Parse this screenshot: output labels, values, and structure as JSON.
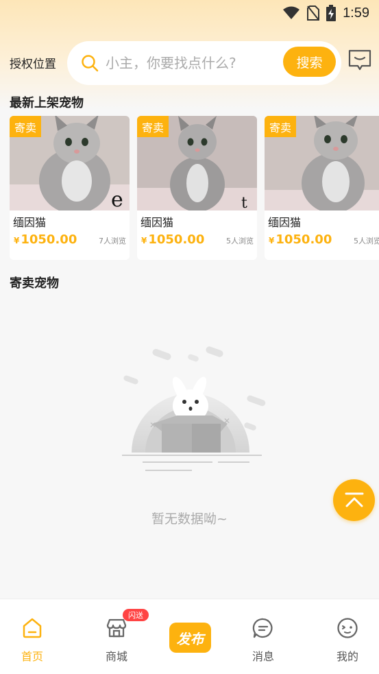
{
  "status_bar": {
    "time": "1:59"
  },
  "header": {
    "location_label": "授权位置",
    "search_placeholder": "小主，你要找点什么?",
    "search_button": "搜索"
  },
  "latest": {
    "title": "最新上架宠物",
    "items": [
      {
        "badge": "寄卖",
        "name": "缅因猫",
        "currency": "¥",
        "price": "1050.00",
        "views": "7人浏览"
      },
      {
        "badge": "寄卖",
        "name": "缅因猫",
        "currency": "¥",
        "price": "1050.00",
        "views": "5人浏览"
      },
      {
        "badge": "寄卖",
        "name": "缅因猫",
        "currency": "¥",
        "price": "1050.00",
        "views": "5人浏览"
      }
    ]
  },
  "consign": {
    "title": "寄卖宠物",
    "empty_text": "暂无数据呦~"
  },
  "tabbar": {
    "items": [
      {
        "label": "首页",
        "icon": "home-icon",
        "active": true
      },
      {
        "label": "商城",
        "icon": "shop-icon",
        "badge": "闪送"
      },
      {
        "label": "发布",
        "icon": "publish-icon"
      },
      {
        "label": "消息",
        "icon": "message-icon"
      },
      {
        "label": "我的",
        "icon": "profile-icon"
      }
    ]
  },
  "colors": {
    "accent": "#fdb20f",
    "badge_red": "#ff4444"
  }
}
